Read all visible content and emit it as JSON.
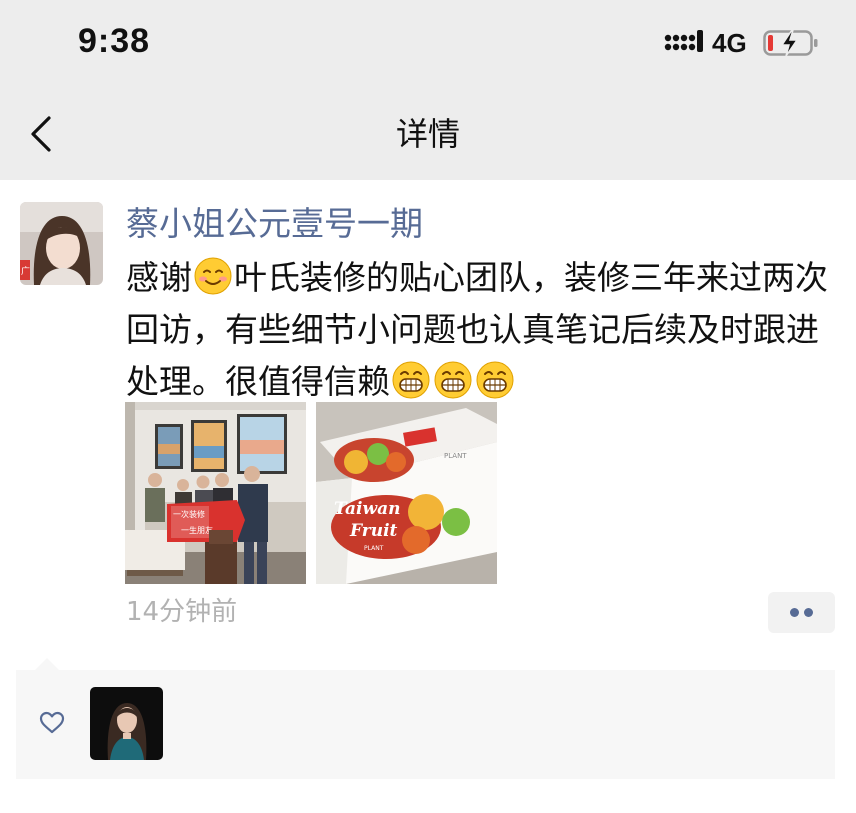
{
  "status_bar": {
    "time": "9:38",
    "network": "4G",
    "icons": [
      "signal-icon",
      "battery-charging-icon"
    ]
  },
  "nav": {
    "title": "详情",
    "back_icon": "chevron-left-icon"
  },
  "post": {
    "author": "蔡小姐公元壹号一期",
    "text_part1": "感谢",
    "text_part2": "叶氏装修的贴心团队，装修三年来过两次回访，有些细节小问题也认真笔记后续及时跟进处理。很值得信赖",
    "emojis": [
      "smiling-face-emoji",
      "grinning-face-emoji",
      "grinning-face-emoji",
      "grinning-face-emoji"
    ],
    "photo_1_banner_line1": "一次装修",
    "photo_1_banner_line2": "一生朋友",
    "photo_2_label_line1": "Taiwan",
    "photo_2_label_line2": "Fruit",
    "photo_2_brand": "PLANT",
    "time_ago": "14分钟前",
    "more_icon": "more-dots-icon"
  },
  "likes": {
    "icon": "heart-icon",
    "count": 1
  },
  "colors": {
    "link_blue": "#576b95",
    "top_bar_bg": "#ededed",
    "likes_bg": "#f7f7f7",
    "muted_text": "#b2b2b2"
  }
}
